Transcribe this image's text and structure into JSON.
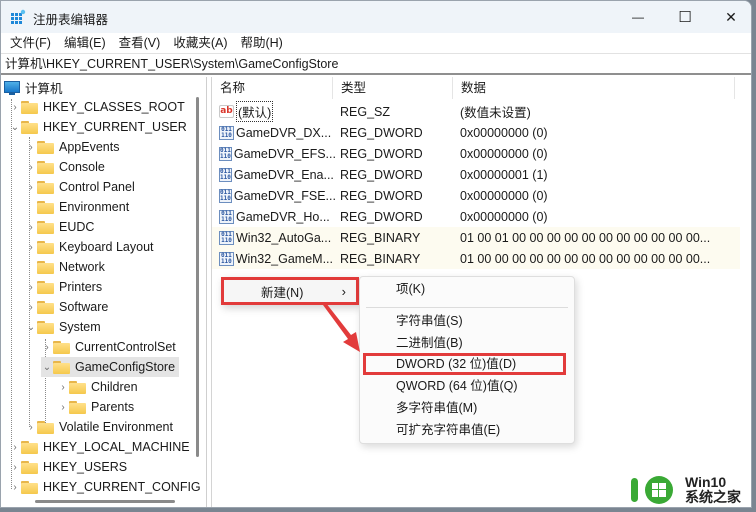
{
  "window": {
    "title": "注册表编辑器",
    "controls": {
      "minimize": "—",
      "maximize": "☐",
      "close": "✕"
    }
  },
  "menubar": {
    "items": [
      {
        "label": "文件(F)"
      },
      {
        "label": "编辑(E)"
      },
      {
        "label": "查看(V)"
      },
      {
        "label": "收藏夹(A)"
      },
      {
        "label": "帮助(H)"
      }
    ]
  },
  "address": {
    "path": "计算机\\HKEY_CURRENT_USER\\System\\GameConfigStore"
  },
  "tree": {
    "root": "计算机",
    "items": [
      {
        "label": "HKEY_CLASSES_ROOT",
        "level": 0,
        "chevron": "›"
      },
      {
        "label": "HKEY_CURRENT_USER",
        "level": 0,
        "chevron": "⌄"
      },
      {
        "label": "AppEvents",
        "level": 1,
        "chevron": "›"
      },
      {
        "label": "Console",
        "level": 1,
        "chevron": "›"
      },
      {
        "label": "Control Panel",
        "level": 1,
        "chevron": "›"
      },
      {
        "label": "Environment",
        "level": 1,
        "chevron": ""
      },
      {
        "label": "EUDC",
        "level": 1,
        "chevron": "›"
      },
      {
        "label": "Keyboard Layout",
        "level": 1,
        "chevron": "›"
      },
      {
        "label": "Network",
        "level": 1,
        "chevron": ""
      },
      {
        "label": "Printers",
        "level": 1,
        "chevron": "›"
      },
      {
        "label": "Software",
        "level": 1,
        "chevron": "›"
      },
      {
        "label": "System",
        "level": 1,
        "chevron": "⌄"
      },
      {
        "label": "CurrentControlSet",
        "level": 2,
        "chevron": "›"
      },
      {
        "label": "GameConfigStore",
        "level": 2,
        "chevron": "⌄",
        "selected": true
      },
      {
        "label": "Children",
        "level": 3,
        "chevron": "›"
      },
      {
        "label": "Parents",
        "level": 3,
        "chevron": "›"
      },
      {
        "label": "Volatile Environment",
        "level": 1,
        "chevron": "›"
      },
      {
        "label": "HKEY_LOCAL_MACHINE",
        "level": 0,
        "chevron": "›"
      },
      {
        "label": "HKEY_USERS",
        "level": 0,
        "chevron": "›"
      },
      {
        "label": "HKEY_CURRENT_CONFIG",
        "level": 0,
        "chevron": "›"
      }
    ]
  },
  "list": {
    "columns": [
      "名称",
      "类型",
      "数据"
    ],
    "rows": [
      {
        "icon": "string-value-icon",
        "name": "(默认)",
        "type": "REG_SZ",
        "data": "(数值未设置)"
      },
      {
        "icon": "binary-value-icon",
        "name": "GameDVR_DX...",
        "type": "REG_DWORD",
        "data": "0x00000000 (0)"
      },
      {
        "icon": "binary-value-icon",
        "name": "GameDVR_EFS...",
        "type": "REG_DWORD",
        "data": "0x00000000 (0)"
      },
      {
        "icon": "binary-value-icon",
        "name": "GameDVR_Ena...",
        "type": "REG_DWORD",
        "data": "0x00000001 (1)"
      },
      {
        "icon": "binary-value-icon",
        "name": "GameDVR_FSE...",
        "type": "REG_DWORD",
        "data": "0x00000000 (0)"
      },
      {
        "icon": "binary-value-icon",
        "name": "GameDVR_Ho...",
        "type": "REG_DWORD",
        "data": "0x00000000 (0)"
      },
      {
        "icon": "binary-value-icon",
        "name": "Win32_AutoGa...",
        "type": "REG_BINARY",
        "data": "01 00 01 00 00 00 00 00 00 00 00 00 00 00..."
      },
      {
        "icon": "binary-value-icon",
        "name": "Win32_GameM...",
        "type": "REG_BINARY",
        "data": "01 00 00 00 00 00 00 00 00 00 00 00 00 00..."
      }
    ]
  },
  "context_menu": {
    "new_label": "新建(N)",
    "new_arrow": "›",
    "submenu": [
      {
        "label": "项(K)"
      },
      {
        "label": "字符串值(S)"
      },
      {
        "label": "二进制值(B)"
      },
      {
        "label": "DWORD (32 位)值(D)",
        "highlighted": true
      },
      {
        "label": "QWORD (64 位)值(Q)"
      },
      {
        "label": "多字符串值(M)"
      },
      {
        "label": "可扩充字符串值(E)"
      }
    ]
  },
  "annotation": {
    "color": "#e23b3b"
  },
  "watermark": {
    "line1": "Win10",
    "line2": "系统之家",
    "color": "#3aa935"
  }
}
